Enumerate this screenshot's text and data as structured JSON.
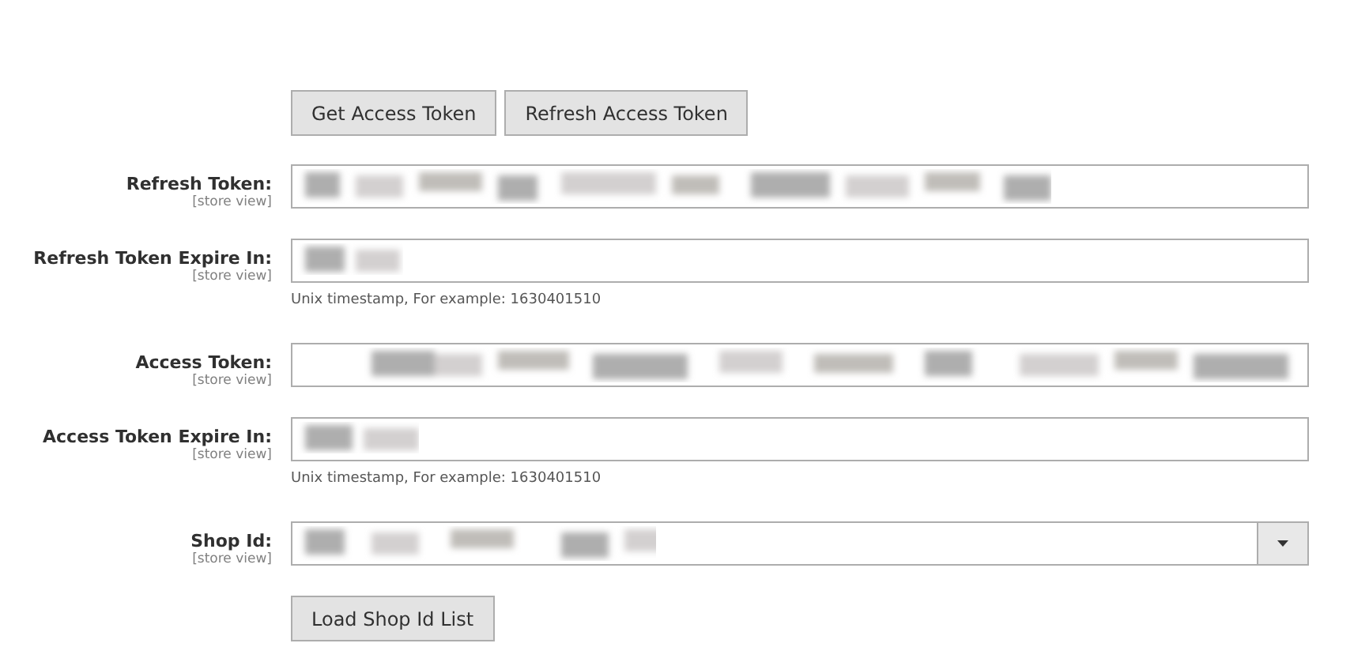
{
  "actions": [
    {
      "label": "Get Access Token"
    },
    {
      "label": "Refresh Access Token"
    }
  ],
  "fields": [
    {
      "kind": "text",
      "label": "Refresh Token:",
      "scope": "[store view]",
      "redacted": true
    },
    {
      "kind": "text",
      "label": "Refresh Token Expire In:",
      "scope": "[store view]",
      "redacted": true,
      "note": "Unix timestamp, For example: 1630401510"
    },
    {
      "kind": "text",
      "label": "Access Token:",
      "scope": "[store view]",
      "redacted": true
    },
    {
      "kind": "text",
      "label": "Access Token Expire In:",
      "scope": "[store view]",
      "redacted": true,
      "note": "Unix timestamp, For example: 1630401510"
    },
    {
      "kind": "select",
      "label": "Shop Id:",
      "scope": "[store view]",
      "redacted": true
    }
  ],
  "bottom_actions": [
    {
      "label": "Load Shop Id List"
    }
  ]
}
